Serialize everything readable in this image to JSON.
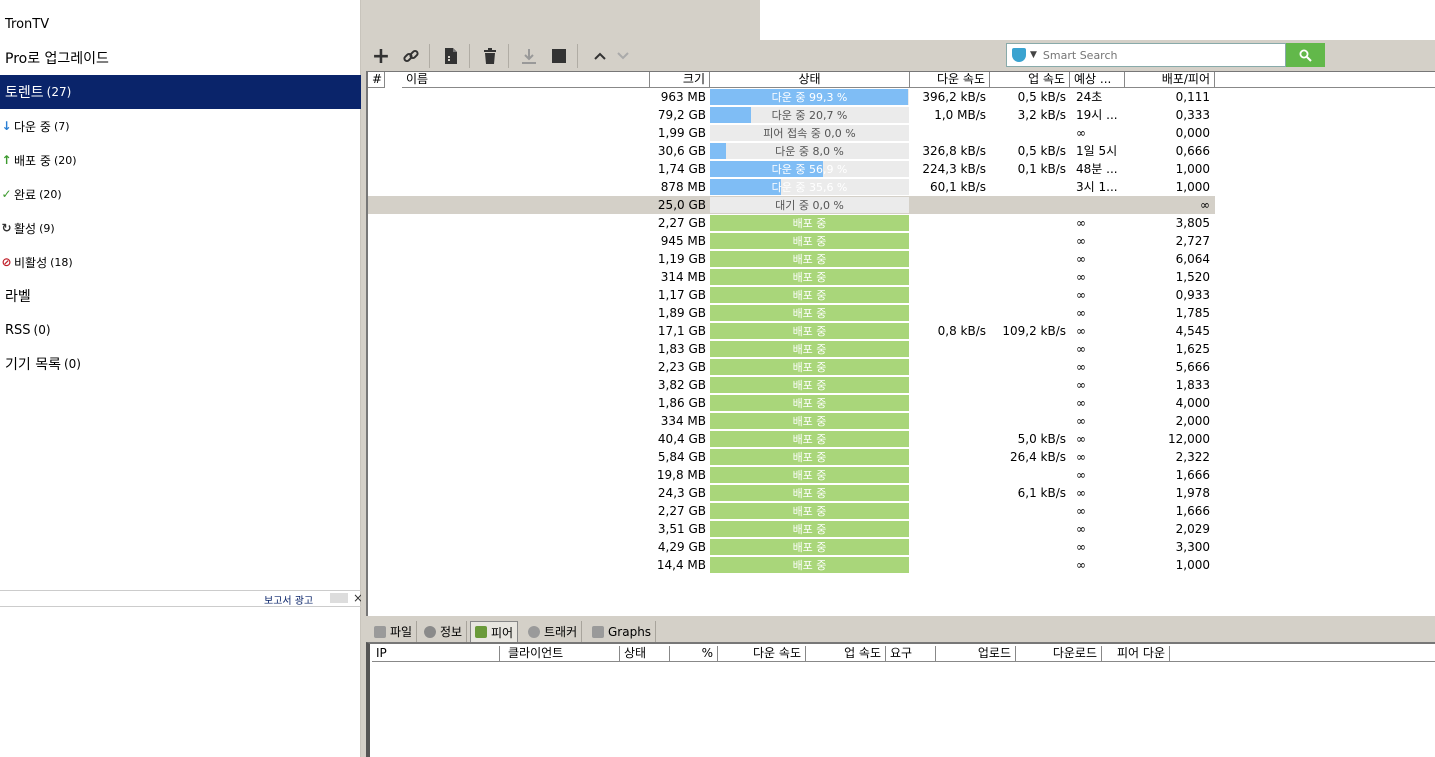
{
  "app": {
    "title": "TronTV"
  },
  "sidebar": {
    "upgrade": "Pro로 업그레이드",
    "torrents": {
      "label": "토렌트",
      "count": "(27)"
    },
    "downloading": {
      "label": "다운 중",
      "count": "(7)"
    },
    "seeding": {
      "label": "배포 중",
      "count": "(20)"
    },
    "completed": {
      "label": "완료",
      "count": "(20)"
    },
    "active": {
      "label": "활성",
      "count": "(9)"
    },
    "inactive": {
      "label": "비활성",
      "count": "(18)"
    },
    "labels": "라벨",
    "rss": {
      "label": "RSS",
      "count": "(0)"
    },
    "devices": {
      "label": "기기 목록",
      "count": "(0)"
    },
    "ad_link": "보고서 광고",
    "ad_close": "×"
  },
  "search": {
    "placeholder": "Smart Search"
  },
  "list": {
    "headers": {
      "num": "#",
      "name": "이름",
      "size": "크기",
      "status": "상태",
      "down": "다운 속도",
      "up": "업 속도",
      "eta": "예상 ...",
      "ratio": "배포/피어"
    },
    "rows": [
      {
        "size": "963 MB",
        "status": "다운 중 99,3 %",
        "progress": 0.993,
        "kind": "dl",
        "down": "396,2 kB/s",
        "up": "0,5 kB/s",
        "eta": "24초",
        "ratio": "0,111"
      },
      {
        "size": "79,2 GB",
        "status": "다운 중 20,7 %",
        "progress": 0.207,
        "kind": "dl",
        "down": "1,0 MB/s",
        "up": "3,2 kB/s",
        "eta": "19시 ...",
        "ratio": "0,333"
      },
      {
        "size": "1,99 GB",
        "status": "피어 접속 중 0,0 %",
        "progress": 0.0,
        "kind": "dl",
        "down": "",
        "up": "",
        "eta": "∞",
        "ratio": "0,000"
      },
      {
        "size": "30,6 GB",
        "status": "다운 중 8,0 %",
        "progress": 0.08,
        "kind": "dl",
        "down": "326,8 kB/s",
        "up": "0,5 kB/s",
        "eta": "1일 5시",
        "ratio": "0,666"
      },
      {
        "size": "1,74 GB",
        "status": "다운 중 56,9 %",
        "progress": 0.569,
        "kind": "dl",
        "down": "224,3 kB/s",
        "up": "0,1 kB/s",
        "eta": "48분 ...",
        "ratio": "1,000"
      },
      {
        "size": "878 MB",
        "status": "다운 중 35,6 %",
        "progress": 0.356,
        "kind": "dl",
        "down": "60,1 kB/s",
        "up": "",
        "eta": "3시 1...",
        "ratio": "1,000"
      },
      {
        "size": "25,0 GB",
        "status": "대기 중 0,0 %",
        "progress": 0.0,
        "kind": "queued",
        "down": "",
        "up": "",
        "eta": "",
        "ratio": "∞"
      },
      {
        "size": "2,27 GB",
        "status": "배포 중",
        "progress": 1,
        "kind": "seed",
        "down": "",
        "up": "",
        "eta": "∞",
        "ratio": "3,805"
      },
      {
        "size": "945 MB",
        "status": "배포 중",
        "progress": 1,
        "kind": "seed",
        "down": "",
        "up": "",
        "eta": "∞",
        "ratio": "2,727"
      },
      {
        "size": "1,19 GB",
        "status": "배포 중",
        "progress": 1,
        "kind": "seed",
        "down": "",
        "up": "",
        "eta": "∞",
        "ratio": "6,064"
      },
      {
        "size": "314 MB",
        "status": "배포 중",
        "progress": 1,
        "kind": "seed",
        "down": "",
        "up": "",
        "eta": "∞",
        "ratio": "1,520"
      },
      {
        "size": "1,17 GB",
        "status": "배포 중",
        "progress": 1,
        "kind": "seed",
        "down": "",
        "up": "",
        "eta": "∞",
        "ratio": "0,933"
      },
      {
        "size": "1,89 GB",
        "status": "배포 중",
        "progress": 1,
        "kind": "seed",
        "down": "",
        "up": "",
        "eta": "∞",
        "ratio": "1,785"
      },
      {
        "size": "17,1 GB",
        "status": "배포 중",
        "progress": 1,
        "kind": "seed",
        "down": "0,8 kB/s",
        "up": "109,2 kB/s",
        "eta": "∞",
        "ratio": "4,545"
      },
      {
        "size": "1,83 GB",
        "status": "배포 중",
        "progress": 1,
        "kind": "seed",
        "down": "",
        "up": "",
        "eta": "∞",
        "ratio": "1,625"
      },
      {
        "size": "2,23 GB",
        "status": "배포 중",
        "progress": 1,
        "kind": "seed",
        "down": "",
        "up": "",
        "eta": "∞",
        "ratio": "5,666"
      },
      {
        "size": "3,82 GB",
        "status": "배포 중",
        "progress": 1,
        "kind": "seed",
        "down": "",
        "up": "",
        "eta": "∞",
        "ratio": "1,833"
      },
      {
        "size": "1,86 GB",
        "status": "배포 중",
        "progress": 1,
        "kind": "seed",
        "down": "",
        "up": "",
        "eta": "∞",
        "ratio": "4,000"
      },
      {
        "size": "334 MB",
        "status": "배포 중",
        "progress": 1,
        "kind": "seed",
        "down": "",
        "up": "",
        "eta": "∞",
        "ratio": "2,000"
      },
      {
        "size": "40,4 GB",
        "status": "배포 중",
        "progress": 1,
        "kind": "seed",
        "down": "",
        "up": "5,0 kB/s",
        "eta": "∞",
        "ratio": "12,000"
      },
      {
        "size": "5,84 GB",
        "status": "배포 중",
        "progress": 1,
        "kind": "seed",
        "down": "",
        "up": "26,4 kB/s",
        "eta": "∞",
        "ratio": "2,322"
      },
      {
        "size": "19,8 MB",
        "status": "배포 중",
        "progress": 1,
        "kind": "seed",
        "down": "",
        "up": "",
        "eta": "∞",
        "ratio": "1,666"
      },
      {
        "size": "24,3 GB",
        "status": "배포 중",
        "progress": 1,
        "kind": "seed",
        "down": "",
        "up": "6,1 kB/s",
        "eta": "∞",
        "ratio": "1,978"
      },
      {
        "size": "2,27 GB",
        "status": "배포 중",
        "progress": 1,
        "kind": "seed",
        "down": "",
        "up": "",
        "eta": "∞",
        "ratio": "1,666"
      },
      {
        "size": "3,51 GB",
        "status": "배포 중",
        "progress": 1,
        "kind": "seed",
        "down": "",
        "up": "",
        "eta": "∞",
        "ratio": "2,029"
      },
      {
        "size": "4,29 GB",
        "status": "배포 중",
        "progress": 1,
        "kind": "seed",
        "down": "",
        "up": "",
        "eta": "∞",
        "ratio": "3,300"
      },
      {
        "size": "14,4 MB",
        "status": "배포 중",
        "progress": 1,
        "kind": "seed",
        "down": "",
        "up": "",
        "eta": "∞",
        "ratio": "1,000"
      }
    ]
  },
  "tabs": {
    "files": "파일",
    "info": "정보",
    "peers": "피어",
    "trackers": "트래커",
    "graphs": "Graphs"
  },
  "peers": {
    "headers": {
      "ip": "IP",
      "client": "클라이언트",
      "status": "상태",
      "pct": "%",
      "down": "다운 속도",
      "up": "업 속도",
      "req": "요구",
      "uploaded": "업로드",
      "downloaded": "다운로드",
      "peer_down": "피어 다운"
    }
  },
  "colors": {
    "download_fill": "#7fbdf5",
    "seed_fill": "#a9d67a",
    "status_bg": "#ebebeb",
    "selection": "#0a246a",
    "search_button": "#62b84a"
  }
}
